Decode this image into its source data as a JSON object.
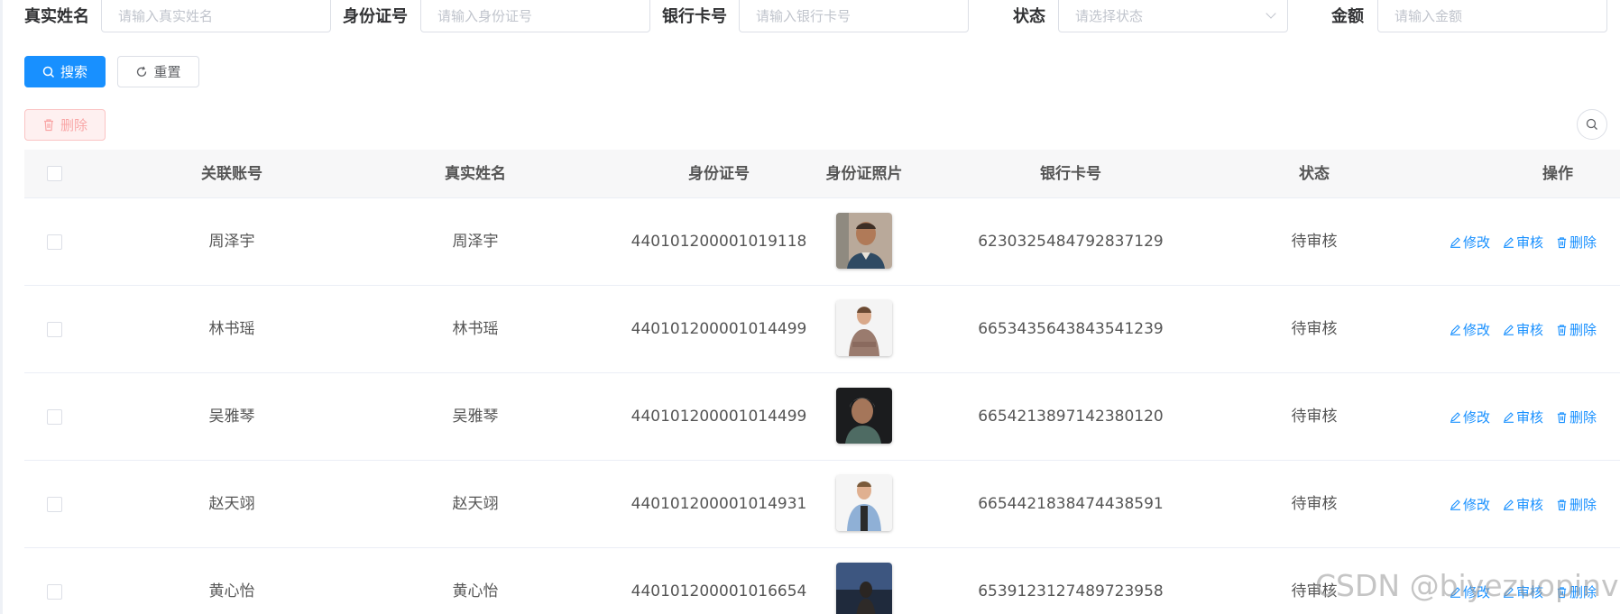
{
  "search_form": {
    "fields": [
      {
        "label": "真实姓名",
        "placeholder": "请输入真实姓名"
      },
      {
        "label": "身份证号",
        "placeholder": "请输入身份证号"
      },
      {
        "label": "银行卡号",
        "placeholder": "请输入银行卡号"
      },
      {
        "label": "状态",
        "placeholder": "请选择状态"
      },
      {
        "label": "金额",
        "placeholder": "请输入金额"
      }
    ],
    "search_label": "搜索",
    "reset_label": "重置"
  },
  "toolbar": {
    "delete_label": "删除"
  },
  "table": {
    "columns": [
      "关联账号",
      "真实姓名",
      "身份证号",
      "身份证照片",
      "银行卡号",
      "状态",
      "操作"
    ],
    "rows": [
      {
        "account": "周泽宇",
        "name": "周泽宇",
        "id_number": "440101200001019118",
        "bank_card": "6230325484792837129",
        "status": "待审核"
      },
      {
        "account": "林书瑶",
        "name": "林书瑶",
        "id_number": "440101200001014499",
        "bank_card": "6653435643843541239",
        "status": "待审核"
      },
      {
        "account": "吴雅琴",
        "name": "吴雅琴",
        "id_number": "440101200001014499",
        "bank_card": "6654213897142380120",
        "status": "待审核"
      },
      {
        "account": "赵天翊",
        "name": "赵天翊",
        "id_number": "440101200001014931",
        "bank_card": "6654421838474438591",
        "status": "待审核"
      },
      {
        "account": "黄心怡",
        "name": "黄心怡",
        "id_number": "440101200001016654",
        "bank_card": "6539123127489723958",
        "status": "待审核"
      }
    ],
    "actions": {
      "edit": "修改",
      "audit": "审核",
      "delete": "删除"
    }
  },
  "watermark": "CSDN @biyezuopinvip",
  "colors": {
    "primary": "#1890ff",
    "danger_plain_bg": "#fef0f0",
    "header_bg": "#f7f7f8"
  }
}
